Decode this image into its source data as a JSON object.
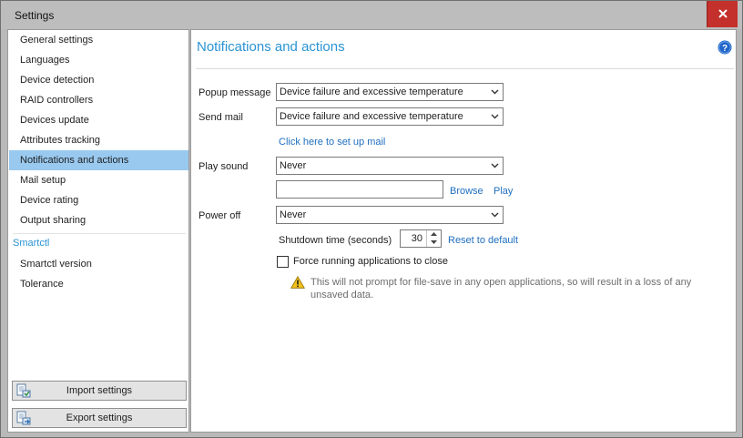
{
  "window": {
    "title": "Settings"
  },
  "sidebar": {
    "items": [
      {
        "label": "General settings"
      },
      {
        "label": "Languages"
      },
      {
        "label": "Device detection"
      },
      {
        "label": "RAID controllers"
      },
      {
        "label": "Devices update"
      },
      {
        "label": "Attributes tracking"
      },
      {
        "label": "Notifications and actions",
        "selected": true
      },
      {
        "label": "Mail setup"
      },
      {
        "label": "Device rating"
      },
      {
        "label": "Output sharing"
      }
    ],
    "section_title": "Smartctl",
    "section_items": [
      {
        "label": "Smartctl version"
      },
      {
        "label": "Tolerance"
      }
    ],
    "import_label": "Import settings",
    "export_label": "Export settings"
  },
  "content": {
    "title": "Notifications and actions",
    "popup_label": "Popup message",
    "popup_value": "Device failure and excessive temperature",
    "sendmail_label": "Send mail",
    "sendmail_value": "Device failure and excessive temperature",
    "mail_setup_link": "Click here to set up mail",
    "playsound_label": "Play sound",
    "playsound_value": "Never",
    "sound_path_value": "",
    "browse_label": "Browse",
    "play_label": "Play",
    "poweroff_label": "Power off",
    "poweroff_value": "Never",
    "shutdown_label": "Shutdown time (seconds)",
    "shutdown_value": "30",
    "reset_link": "Reset to default",
    "force_close_label": "Force running applications to close",
    "force_close_checked": false,
    "warning_text": "This will not prompt for file-save in any open applications, so will result in a loss of any unsaved data."
  },
  "colors": {
    "accent": "#2a93d5",
    "selection": "#99c9ef",
    "close": "#c4302b",
    "link": "#1f6fbf"
  },
  "icons": {
    "close": "close-icon",
    "help": "help-icon",
    "import": "import-icon",
    "export": "export-icon",
    "warning": "warning-icon",
    "dropdown": "chevron-down-icon"
  }
}
